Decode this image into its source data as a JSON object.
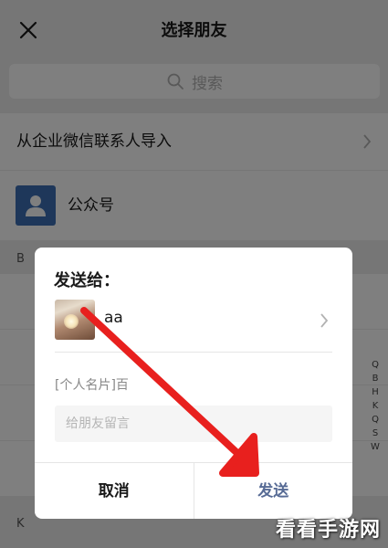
{
  "header": {
    "title": "选择朋友"
  },
  "search": {
    "placeholder": "搜索"
  },
  "list": {
    "import_label": "从企业微信联系人导入",
    "official_label": "公众号",
    "section_b": "B",
    "section_k": "K"
  },
  "index_letters": [
    "Q",
    "B",
    "H",
    "K",
    "Q",
    "S",
    "W"
  ],
  "dialog": {
    "title": "发送给：",
    "recipient_name": "aa",
    "card_text": "[个人名片]百",
    "message_placeholder": "给朋友留言",
    "cancel_label": "取消",
    "send_label": "发送"
  },
  "watermark": "看看手游网",
  "colors": {
    "send_button": "#576b95",
    "annotation_arrow": "#e8201e",
    "official_icon_bg": "#3c6eb4"
  }
}
